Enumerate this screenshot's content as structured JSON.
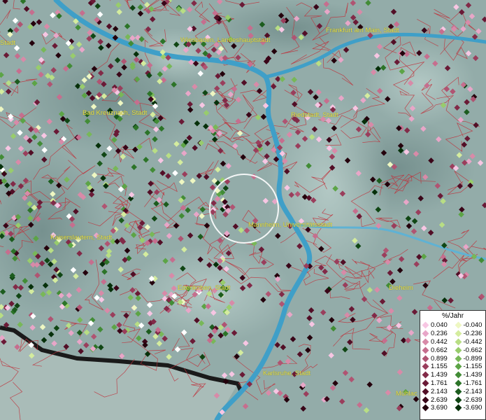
{
  "map": {
    "cities": [
      {
        "name": "Wiesbaden, Landeshauptstadt"
      },
      {
        "name": "Frankfurt am Main, Stadt"
      },
      {
        "name": "Stadt"
      },
      {
        "name": "Bad Kreuznach, Stadt"
      },
      {
        "name": "Riedstadt, Stadt"
      },
      {
        "name": "Kaiserslautern, Stadt"
      },
      {
        "name": "Mannheim, Universitätsstadt"
      },
      {
        "name": "Edenkoben, Stadt"
      },
      {
        "name": "Dieheim"
      },
      {
        "name": "Karlsruhe, Stadt"
      },
      {
        "name": "Mühlac"
      }
    ],
    "colors": {
      "river": "#3f9fc8",
      "border": "#c0303a",
      "coast": "#1a1a1a"
    }
  },
  "legend": {
    "title": "%/Jahr",
    "positive": [
      {
        "label": "0.040",
        "color": "#f7c6e3"
      },
      {
        "label": "0.236",
        "color": "#e8a6c8"
      },
      {
        "label": "0.442",
        "color": "#d88aa8"
      },
      {
        "label": "0.662",
        "color": "#c66e8e"
      },
      {
        "label": "0.899",
        "color": "#b05472"
      },
      {
        "label": "1.155",
        "color": "#9a3e5c"
      },
      {
        "label": "1.439",
        "color": "#822a48"
      },
      {
        "label": "1.761",
        "color": "#6a1a36"
      },
      {
        "label": "2.143",
        "color": "#520e26"
      },
      {
        "label": "2.639",
        "color": "#3a0518"
      },
      {
        "label": "3.690",
        "color": "#24000c"
      }
    ],
    "negative": [
      {
        "label": "-0.040",
        "color": "#eef7c2"
      },
      {
        "label": "-0.236",
        "color": "#d4ec9e"
      },
      {
        "label": "-0.442",
        "color": "#b8de84"
      },
      {
        "label": "-0.662",
        "color": "#98cc6c"
      },
      {
        "label": "-0.899",
        "color": "#78b858"
      },
      {
        "label": "-1.155",
        "color": "#5ca446"
      },
      {
        "label": "-1.439",
        "color": "#428c36"
      },
      {
        "label": "-1.761",
        "color": "#2c7428"
      },
      {
        "label": "-2.143",
        "color": "#1c5c1e"
      },
      {
        "label": "-2.639",
        "color": "#104614"
      },
      {
        "label": "-3.690",
        "color": "#06300a"
      }
    ]
  }
}
